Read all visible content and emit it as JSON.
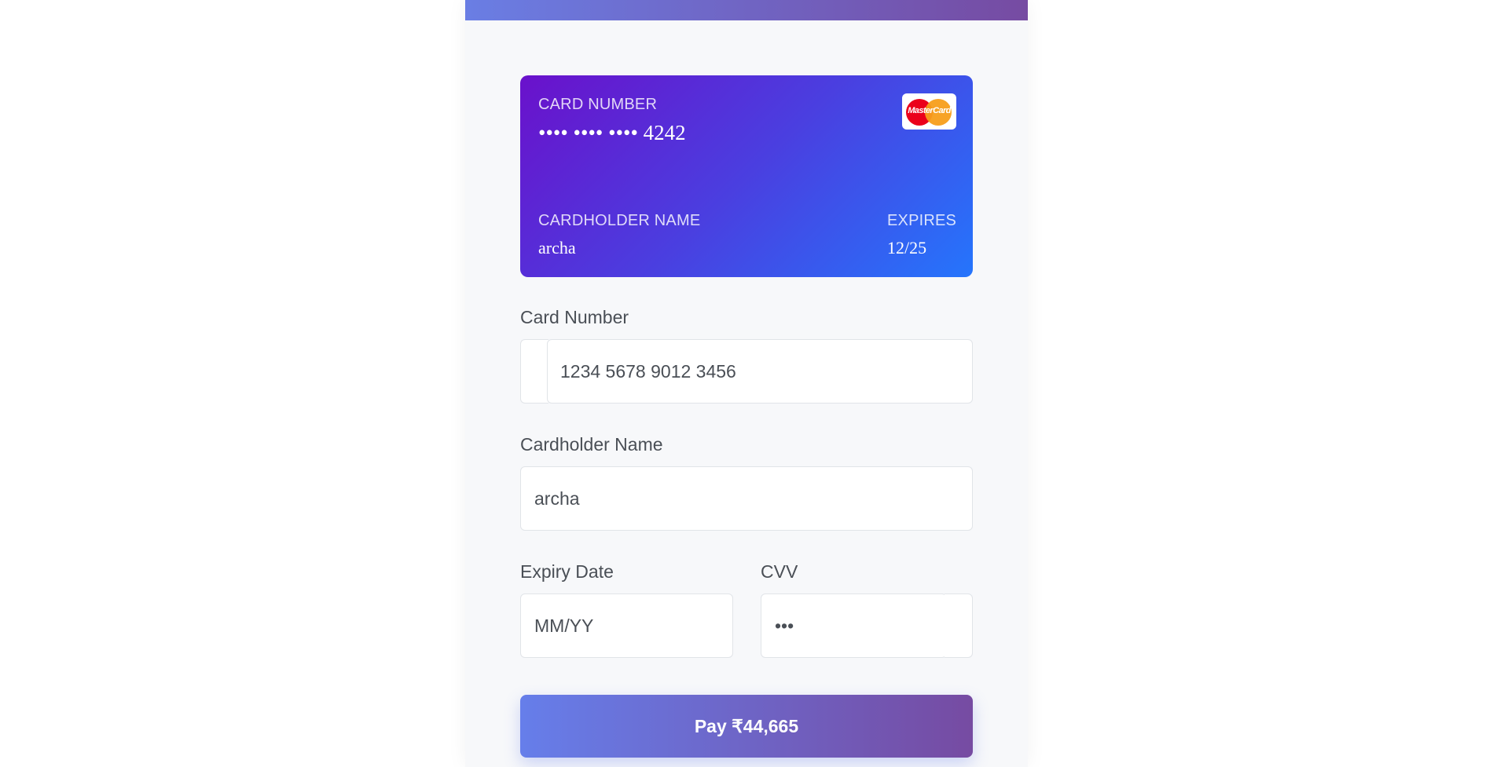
{
  "card_preview": {
    "number_label": "CARD NUMBER",
    "number_value": "•••• •••• •••• 4242",
    "holder_label": "CARDHOLDER NAME",
    "holder_value": "archa",
    "expires_label": "EXPIRES",
    "expires_value": "12/25",
    "brand": "MasterCard",
    "brand_icon": "mastercard-logo-icon"
  },
  "form": {
    "card_number": {
      "label": "Card Number",
      "placeholder": "1234 5678 9012 3456",
      "value": ""
    },
    "cardholder_name": {
      "label": "Cardholder Name",
      "value": "archa"
    },
    "expiry": {
      "label": "Expiry Date",
      "placeholder": "MM/YY",
      "value": ""
    },
    "cvv": {
      "label": "CVV",
      "value": "•••"
    }
  },
  "pay_button": {
    "label": "Pay ₹44,665"
  },
  "colors": {
    "accent_start": "#667eea",
    "accent_end": "#764ba2",
    "card_start": "#6a11cb",
    "card_end": "#2575fc"
  }
}
